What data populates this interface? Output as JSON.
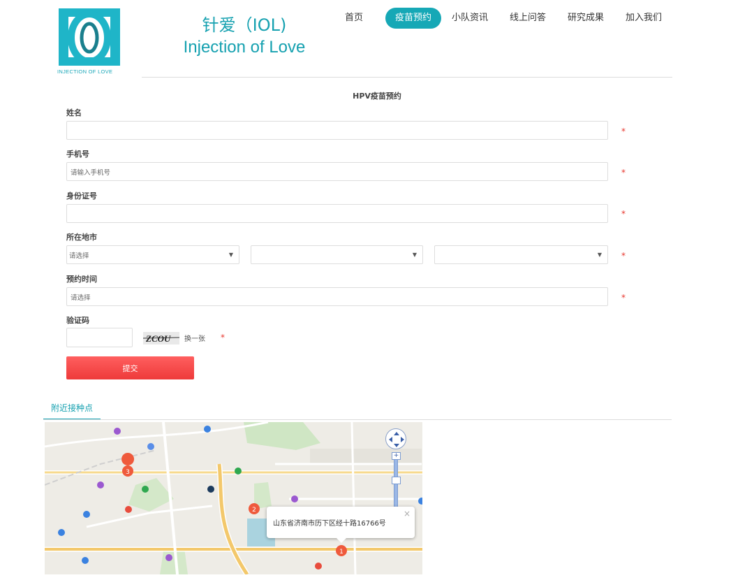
{
  "brand": {
    "title_cn": "针爱（IOL)",
    "title_en": "Injection of Love",
    "logo_caption": "INJECTION OF LOVE",
    "accent_color": "#16a1b0"
  },
  "nav": {
    "items": [
      {
        "label": "首页",
        "active": false
      },
      {
        "label": "疫苗预约",
        "active": true
      },
      {
        "label": "小队资讯",
        "active": false
      },
      {
        "label": "线上问答",
        "active": false
      },
      {
        "label": "研究成果",
        "active": false
      },
      {
        "label": "加入我们",
        "active": false
      }
    ]
  },
  "form": {
    "title": "HPV疫苗预约",
    "name": {
      "label": "姓名",
      "value": "",
      "placeholder": ""
    },
    "phone": {
      "label": "手机号",
      "placeholder": "请输入手机号"
    },
    "id_number": {
      "label": "身份证号",
      "value": ""
    },
    "region": {
      "label": "所在地市",
      "province": {
        "value": "请选择"
      },
      "city": {
        "value": ""
      },
      "district": {
        "value": ""
      }
    },
    "appointment_time": {
      "label": "预约时间",
      "placeholder": "请选择"
    },
    "captcha": {
      "label": "验证码",
      "image_text": "ZCOU",
      "refresh_label": "换一张"
    },
    "required_mark": "*",
    "submit_label": "提交",
    "submit_color": "#f04545"
  },
  "nearby": {
    "tab_label": "附近接种点",
    "popup_text": "山东省济南市历下区经十路16766号",
    "close_glyph": "×",
    "markers": [
      "1",
      "2",
      "3"
    ],
    "zoom_in": "+",
    "zoom_out": "−"
  }
}
